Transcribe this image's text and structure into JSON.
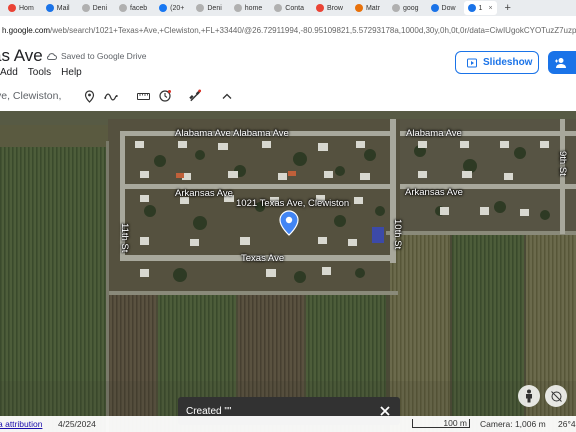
{
  "browser": {
    "tabs": [
      {
        "label": "Hom",
        "color": "#ea4335",
        "active": false
      },
      {
        "label": "Mail",
        "color": "#1a73e8",
        "active": false
      },
      {
        "label": "Deni",
        "color": "#b0b0b0",
        "active": false
      },
      {
        "label": "faceb",
        "color": "#b0b0b0",
        "active": false
      },
      {
        "label": "(20+",
        "color": "#1877f2",
        "active": false
      },
      {
        "label": "Deni",
        "color": "#b0b0b0",
        "active": false
      },
      {
        "label": "home",
        "color": "#b0b0b0",
        "active": false
      },
      {
        "label": "Conta",
        "color": "#b0b0b0",
        "active": false
      },
      {
        "label": "Brow",
        "color": "#ea4335",
        "active": false
      },
      {
        "label": "Matr",
        "color": "#e8710a",
        "active": false
      },
      {
        "label": "goog",
        "color": "#b0b0b0",
        "active": false
      },
      {
        "label": "Dow",
        "color": "#1a73e8",
        "active": false
      },
      {
        "label": "1",
        "color": "#1a73e8",
        "active": true
      }
    ],
    "new_tab_glyph": "+",
    "url_host": "h.google.com",
    "url_rest": "/web/search/1021+Texas+Ave,+Clewiston,+FL+33440/@26.72911994,-80.95109821,5.57293178a,1000d,30y,0h,0t,0r/data=CiwIUgokCYOTuzZ7uzpAEZt"
  },
  "document": {
    "title": "as Ave",
    "saved_status": "Saved to Google Drive",
    "menu": [
      "Add",
      "Tools",
      "Help"
    ],
    "slideshow_label": "Slideshow"
  },
  "toolbar": {
    "search_value": "ve, Clewiston,"
  },
  "map": {
    "labels": {
      "alabama_1": "Alabama Ave",
      "alabama_2": "Alabama Ave",
      "alabama_3": "Alabama Ave",
      "arkansas_1": "Arkansas Ave",
      "arkansas_2": "Arkansas Ave",
      "address": "1021 Texas Ave, Clewiston",
      "texas": "Texas Ave",
      "st_11th": "11th St",
      "st_10th": "10th St",
      "st_9th": "9th St"
    }
  },
  "toast": {
    "text": "Created \"\""
  },
  "status": {
    "attribution": "a attribution",
    "date": "4/25/2024",
    "scale": "100 m",
    "camera": "Camera: 1,006 m",
    "coord": "26°4"
  },
  "colors": {
    "accent": "#1a73e8",
    "pin": "#4285f4"
  }
}
